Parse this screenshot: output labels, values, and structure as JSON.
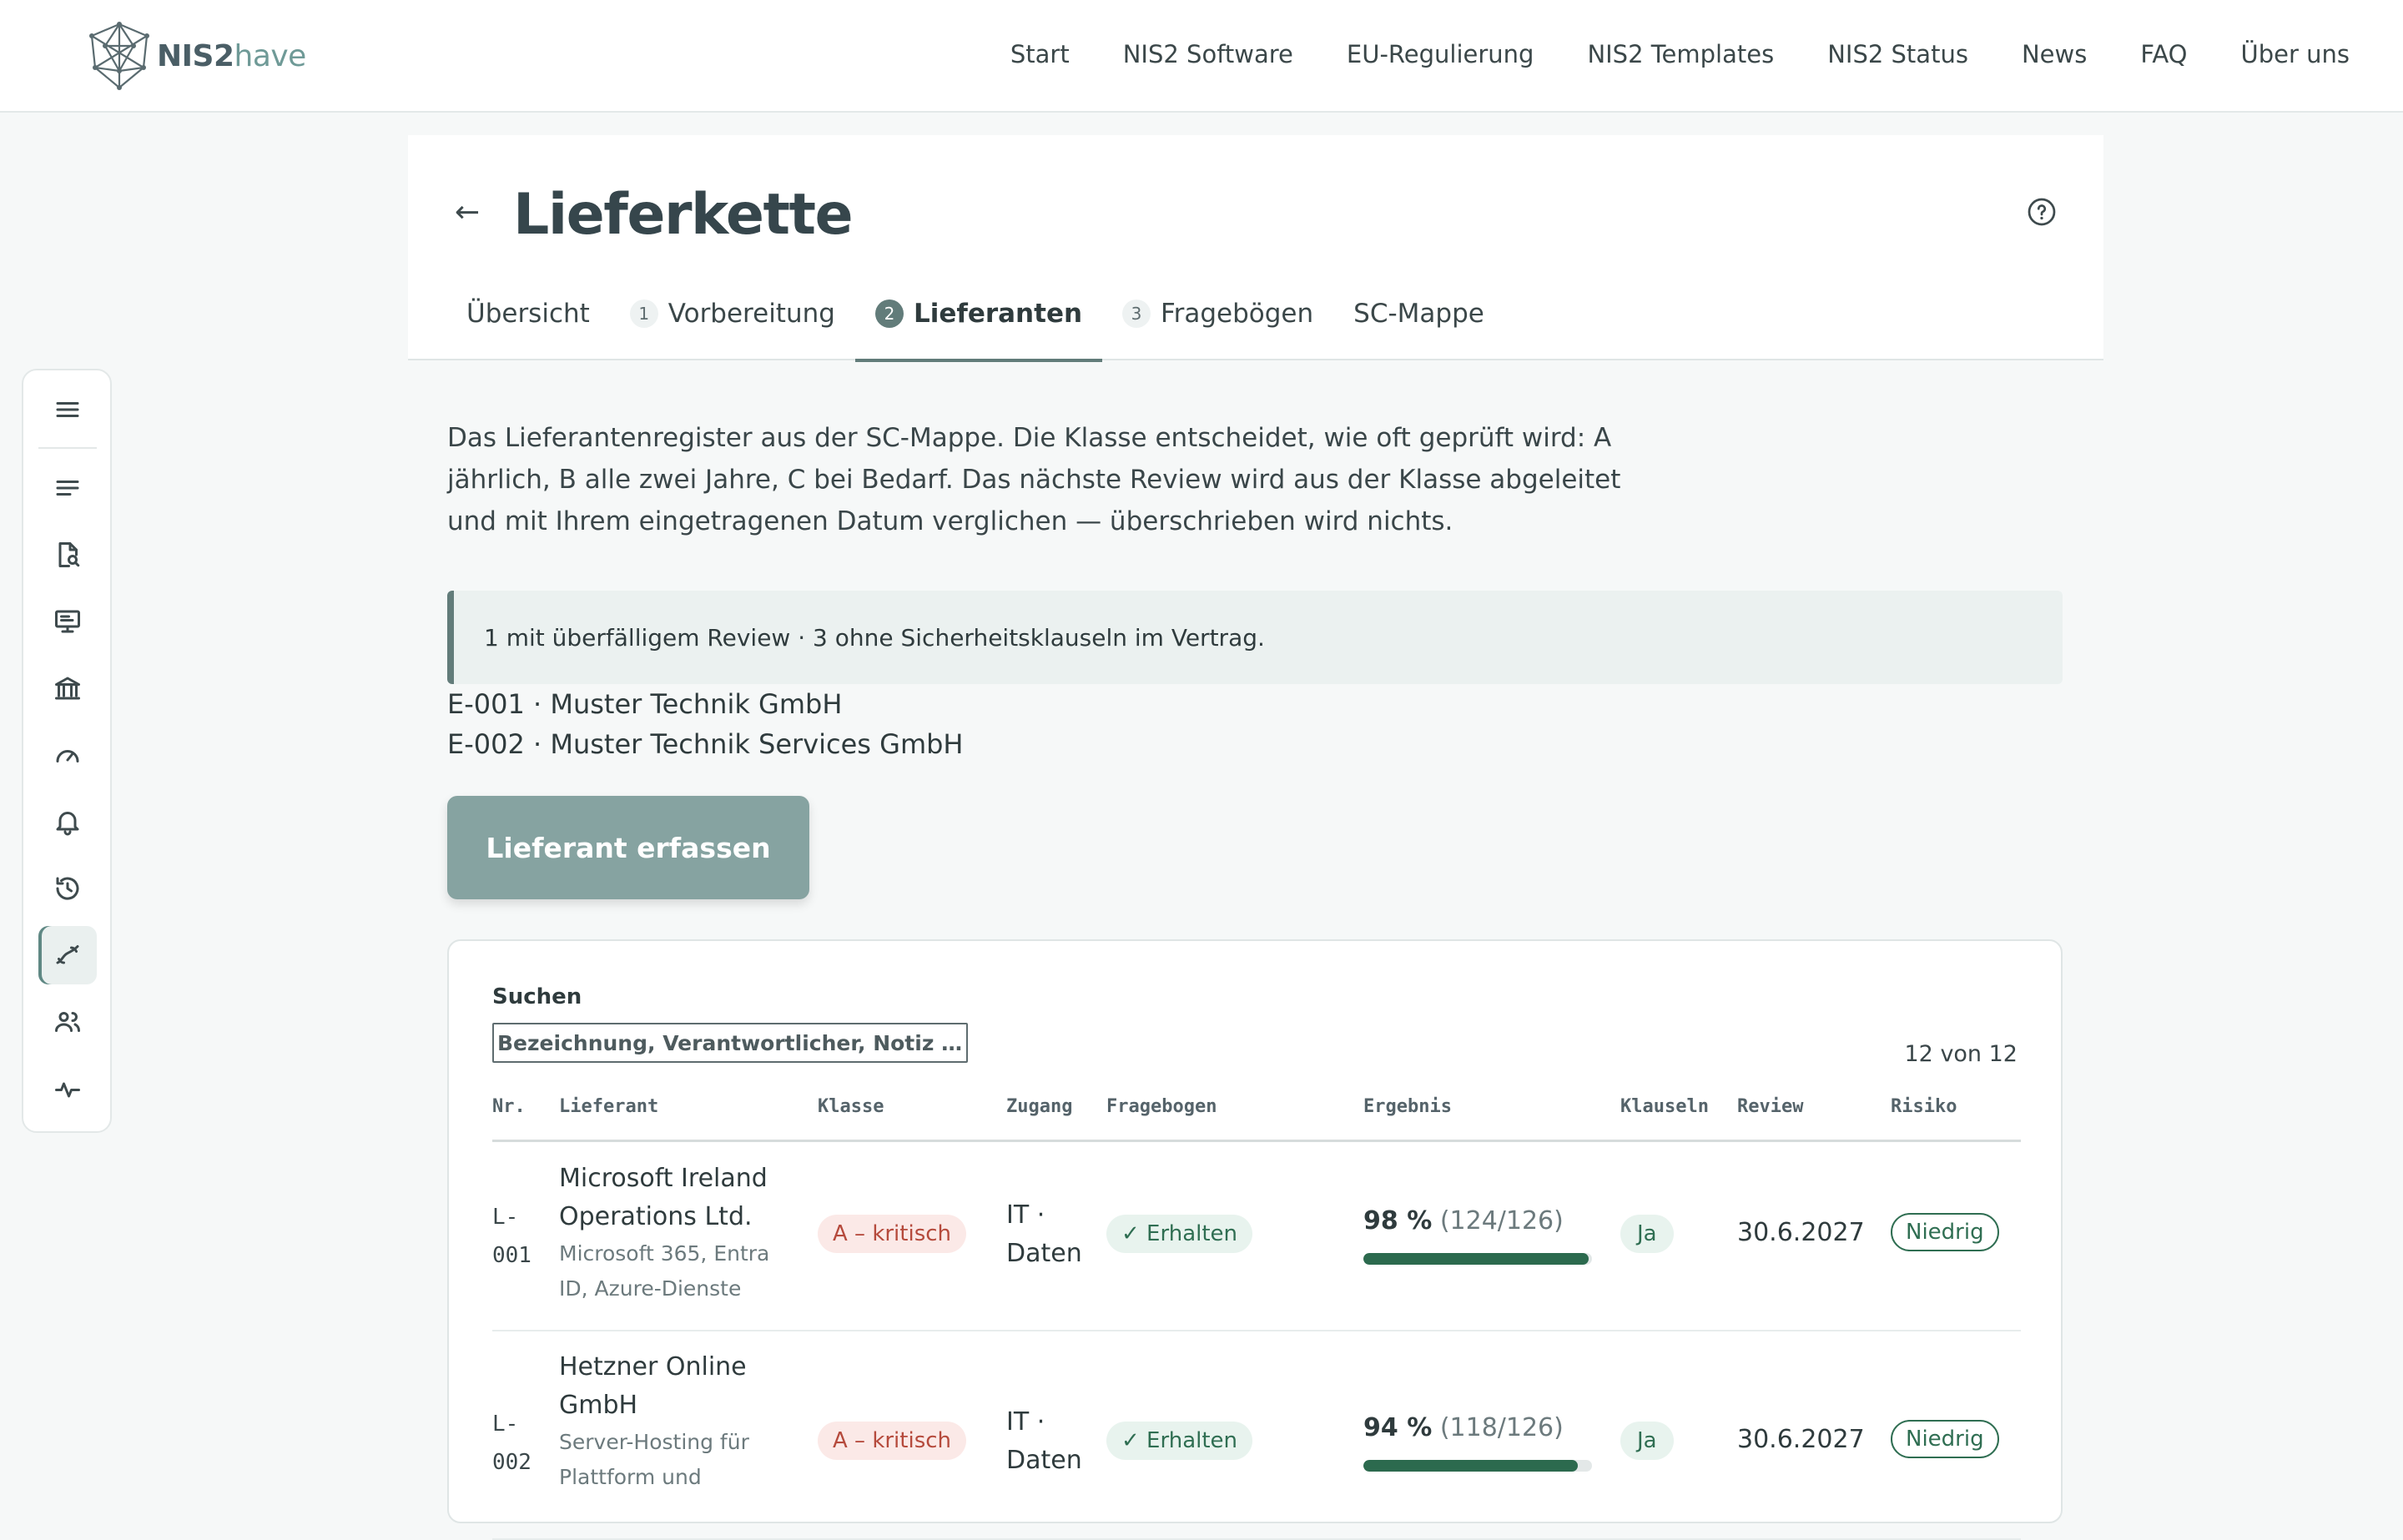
{
  "brand": {
    "logo_bold": "NIS2",
    "logo_light": "have"
  },
  "nav": [
    "Start",
    "NIS2 Software",
    "EU-Regulierung",
    "NIS2 Templates",
    "NIS2 Status",
    "News",
    "FAQ",
    "Über uns"
  ],
  "page": {
    "back_glyph": "←",
    "title": "Lieferkette",
    "tabs": [
      {
        "num": "",
        "label": "Übersicht"
      },
      {
        "num": "1",
        "label": "Vorbereitung"
      },
      {
        "num": "2",
        "label": "Lieferanten"
      },
      {
        "num": "3",
        "label": "Fragebögen"
      },
      {
        "num": "",
        "label": "SC-Mappe"
      }
    ],
    "intro": "Das Lieferantenregister aus der SC-Mappe. Die Klasse entscheidet, wie oft geprüft wird: A jährlich, B alle zwei Jahre, C bei Bedarf. Das nächste Review wird aus der Klasse abgeleitet und mit Ihrem eingetragenen Datum verglichen — überschrieben wird nichts.",
    "alert": "1 mit überfälligem Review · 3 ohne Sicherheitsklauseln im Vertrag.",
    "alert_items": [
      "E-001 · Muster Technik GmbH",
      "E-002 · Muster Technik Services GmbH"
    ],
    "add_button": "Lieferant erfassen"
  },
  "table": {
    "search_label": "Suchen",
    "search_placeholder": "Bezeichnung, Verantwortlicher, Notiz …",
    "count": "12 von 12",
    "headers": {
      "nr": "Nr.",
      "lieferant": "Lieferant",
      "klasse": "Klasse",
      "zugang": "Zugang",
      "fragebogen": "Fragebogen",
      "ergebnis": "Ergebnis",
      "klauseln": "Klauseln",
      "review": "Review",
      "risiko": "Risiko"
    },
    "rows": [
      {
        "nr1": "L-",
        "nr2": "001",
        "name": "Microsoft Ireland Operations Ltd.",
        "desc": "Microsoft 365, Entra ID, Azure-Dienste",
        "klasse": "A – kritisch",
        "zugang1": "IT ·",
        "zugang2": "Daten",
        "fragebogen": "✓ Erhalten",
        "pct": "98 %",
        "score": "(124/126)",
        "progress": 0.984,
        "klauseln": "Ja",
        "review": "30.6.2027",
        "risiko": "Niedrig"
      },
      {
        "nr1": "L-",
        "nr2": "002",
        "name": "Hetzner Online GmbH",
        "desc": "Server-Hosting für Plattform und",
        "klasse": "A – kritisch",
        "zugang1": "IT ·",
        "zugang2": "Daten",
        "fragebogen": "✓ Erhalten",
        "pct": "94 %",
        "score": "(118/126)",
        "progress": 0.937,
        "klauseln": "Ja",
        "review": "30.6.2027",
        "risiko": "Niedrig"
      }
    ]
  },
  "colors": {
    "accent": "#627c7a",
    "button": "#86a3a1",
    "progress": "#2c6a4e",
    "critical": "#b54a3c"
  }
}
